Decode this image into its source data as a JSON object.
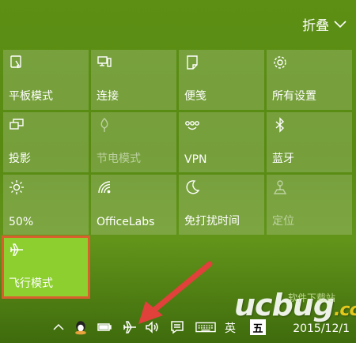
{
  "header": {
    "collapse_label": "折叠"
  },
  "tiles": [
    {
      "label": "平板模式",
      "icon": "tablet-mode-icon",
      "state": "normal"
    },
    {
      "label": "连接",
      "icon": "connect-icon",
      "state": "normal"
    },
    {
      "label": "便笺",
      "icon": "note-icon",
      "state": "normal"
    },
    {
      "label": "所有设置",
      "icon": "gear-icon",
      "state": "normal"
    },
    {
      "label": "投影",
      "icon": "project-icon",
      "state": "normal"
    },
    {
      "label": "节电模式",
      "icon": "battery-saver-icon",
      "state": "disabled"
    },
    {
      "label": "VPN",
      "icon": "vpn-icon",
      "state": "normal"
    },
    {
      "label": "蓝牙",
      "icon": "bluetooth-icon",
      "state": "normal"
    },
    {
      "label": "50%",
      "icon": "brightness-icon",
      "state": "normal"
    },
    {
      "label": "OfficeLabs",
      "icon": "wifi-icon",
      "state": "normal"
    },
    {
      "label": "免打扰时间",
      "icon": "moon-icon",
      "state": "normal"
    },
    {
      "label": "定位",
      "icon": "location-icon",
      "state": "disabled"
    },
    {
      "label": "飞行模式",
      "icon": "airplane-icon",
      "state": "active"
    }
  ],
  "taskbar": {
    "ime_label": "英",
    "ime_box": "五",
    "clock": "2015/12/1"
  },
  "watermark": {
    "main": "ucbug",
    "suffix": ".cc",
    "sub": "软件下载站"
  },
  "colors": {
    "active_tile": "#8ccf2e",
    "highlight": "#d9602e",
    "arrow": "#e0413a"
  }
}
